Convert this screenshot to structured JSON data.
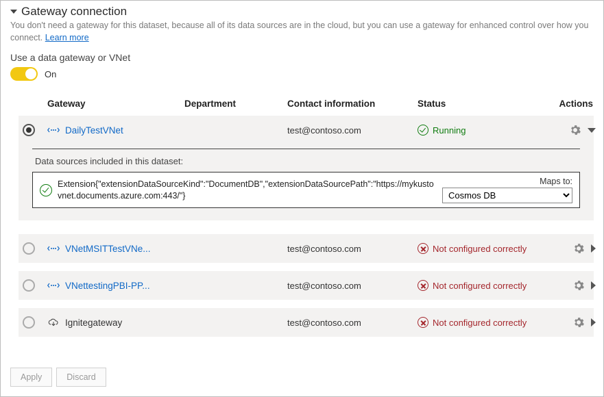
{
  "header": {
    "title": "Gateway connection",
    "description_pre": "You don't need a gateway for this dataset, because all of its data sources are in the cloud, but you can use a gateway for enhanced control over how you connect. ",
    "learn_more": "Learn more"
  },
  "toggle": {
    "label": "Use a data gateway or VNet",
    "state_label": "On"
  },
  "columns": {
    "gateway": "Gateway",
    "department": "Department",
    "contact": "Contact information",
    "status": "Status",
    "actions": "Actions"
  },
  "gateways": [
    {
      "name": "DailyTestVNet",
      "icon": "vnet",
      "department": "",
      "contact": "test@contoso.com",
      "status_text": "Running",
      "status_kind": "ok",
      "selected": true,
      "expanded": true
    },
    {
      "name": "VNetMSITTestVNe...",
      "icon": "vnet",
      "department": "",
      "contact": "test@contoso.com",
      "status_text": "Not configured correctly",
      "status_kind": "bad",
      "selected": false,
      "expanded": false
    },
    {
      "name": "VNettestingPBI-PP...",
      "icon": "vnet",
      "department": "",
      "contact": "test@contoso.com",
      "status_text": "Not configured correctly",
      "status_kind": "bad",
      "selected": false,
      "expanded": false
    },
    {
      "name": "Ignitegateway",
      "icon": "onprem",
      "department": "",
      "contact": "test@contoso.com",
      "status_text": "Not configured correctly",
      "status_kind": "bad",
      "selected": false,
      "expanded": false
    }
  ],
  "datasource_panel": {
    "heading": "Data sources included in this dataset:",
    "source_text": "Extension{\"extensionDataSourceKind\":\"DocumentDB\",\"extensionDataSourcePath\":\"https://mykustovnet.documents.azure.com:443/\"}",
    "maps_to_label": "Maps to:",
    "maps_to_value": "Cosmos DB"
  },
  "buttons": {
    "apply": "Apply",
    "discard": "Discard"
  }
}
